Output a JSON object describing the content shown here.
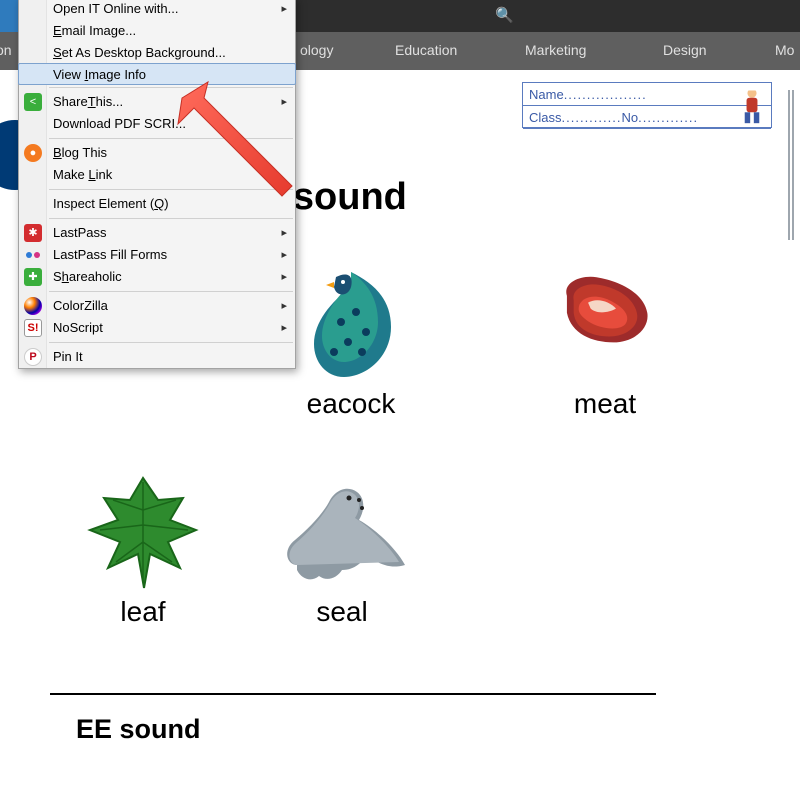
{
  "topbar": {
    "search_icon": "🔍"
  },
  "nav": {
    "items": [
      "on",
      "ology",
      "Education",
      "Marketing",
      "Design",
      "Mo"
    ]
  },
  "info_box": {
    "name_label": "Name",
    "class_label": "Class",
    "no_label": "No",
    "dots": "..................",
    "dots_short": "............."
  },
  "heading": "ng E sound",
  "worksheet": {
    "peacock_caption_partial": "eacock",
    "meat_caption": "meat",
    "leaf_caption": "leaf",
    "seal_caption": "seal"
  },
  "subheading": "EE sound",
  "context_menu": {
    "items": [
      {
        "label": "Open IT Online with...",
        "submenu": true,
        "mn": ""
      },
      {
        "label": "Email Image...",
        "mn": "E"
      },
      {
        "label": "Set As Desktop Background...",
        "mn": "S"
      },
      {
        "label": "View Image Info",
        "mn": "I",
        "hover": true
      },
      {
        "sep": true
      },
      {
        "label": "ShareThis...",
        "icon": "share-icon",
        "submenu": true,
        "mn": "T"
      },
      {
        "label": "Download PDF SCRI...",
        "mn": ""
      },
      {
        "sep": true
      },
      {
        "label": "Blog This",
        "icon": "blog-icon",
        "mn": "B"
      },
      {
        "label": "Make Link",
        "mn": "L"
      },
      {
        "sep": true
      },
      {
        "label": "Inspect Element (Q)",
        "mn": "Q"
      },
      {
        "sep": true
      },
      {
        "label": "LastPass",
        "icon": "lastpass-icon",
        "submenu": true
      },
      {
        "label": "LastPass Fill Forms",
        "icon": "lastpass-fill-icon",
        "submenu": true
      },
      {
        "label": "Shareaholic",
        "icon": "shareaholic-icon",
        "submenu": true,
        "mn": "h"
      },
      {
        "sep": true
      },
      {
        "label": "ColorZilla",
        "icon": "colorzilla-icon",
        "submenu": true
      },
      {
        "label": "NoScript",
        "icon": "noscript-icon",
        "submenu": true
      },
      {
        "sep": true
      },
      {
        "label": "Pin It",
        "icon": "pinterest-icon"
      }
    ]
  }
}
